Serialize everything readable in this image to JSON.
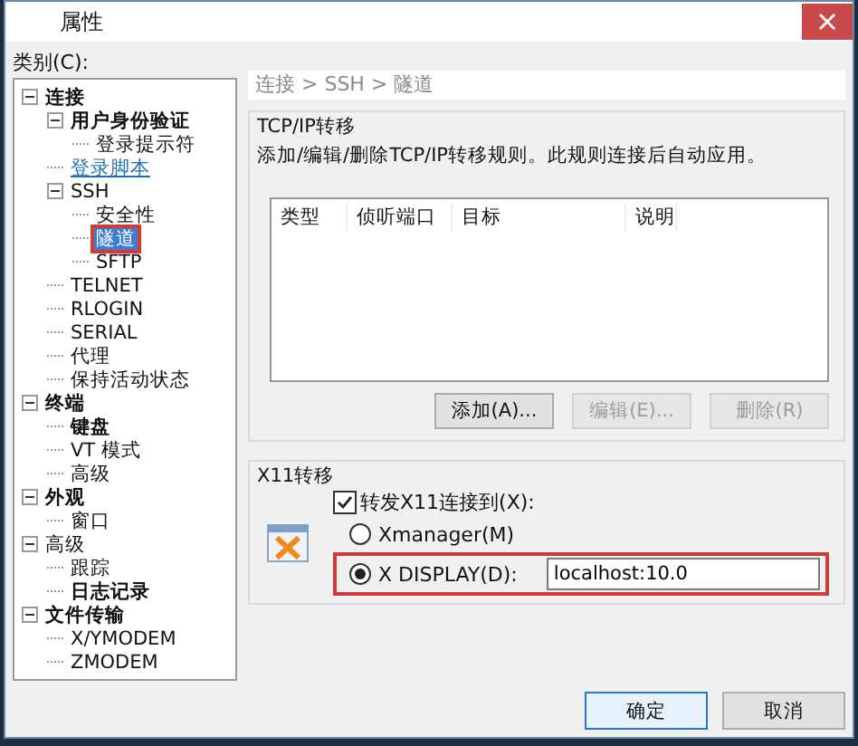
{
  "window": {
    "title": "属性"
  },
  "category_label": "类别(C):",
  "tree": [
    {
      "label": "连接",
      "kind": "bold",
      "expanded": true,
      "selected": false,
      "children": [
        {
          "label": "用户身份验证",
          "kind": "bold",
          "expanded": true,
          "selected": false,
          "children": [
            {
              "label": "登录提示符",
              "kind": "normal",
              "selected": false
            }
          ]
        },
        {
          "label": "登录脚本",
          "kind": "link",
          "selected": false
        },
        {
          "label": "SSH",
          "kind": "normal",
          "expanded": true,
          "selected": false,
          "children": [
            {
              "label": "安全性",
              "kind": "normal",
              "selected": false
            },
            {
              "label": "隧道",
              "kind": "normal",
              "selected": true
            },
            {
              "label": "SFTP",
              "kind": "normal",
              "selected": false
            }
          ]
        },
        {
          "label": "TELNET",
          "kind": "normal",
          "selected": false
        },
        {
          "label": "RLOGIN",
          "kind": "normal",
          "selected": false
        },
        {
          "label": "SERIAL",
          "kind": "normal",
          "selected": false
        },
        {
          "label": "代理",
          "kind": "normal",
          "selected": false
        },
        {
          "label": "保持活动状态",
          "kind": "normal",
          "selected": false
        }
      ]
    },
    {
      "label": "终端",
      "kind": "bold",
      "expanded": true,
      "selected": false,
      "children": [
        {
          "label": "键盘",
          "kind": "bold",
          "selected": false
        },
        {
          "label": "VT 模式",
          "kind": "normal",
          "selected": false
        },
        {
          "label": "高级",
          "kind": "normal",
          "selected": false
        }
      ]
    },
    {
      "label": "外观",
      "kind": "bold",
      "expanded": true,
      "selected": false,
      "children": [
        {
          "label": "窗口",
          "kind": "normal",
          "selected": false
        }
      ]
    },
    {
      "label": "高级",
      "kind": "normal",
      "expanded": true,
      "selected": false,
      "children": [
        {
          "label": "跟踪",
          "kind": "normal",
          "selected": false
        },
        {
          "label": "日志记录",
          "kind": "bold",
          "selected": false
        }
      ]
    },
    {
      "label": "文件传输",
      "kind": "bold",
      "expanded": true,
      "selected": false,
      "children": [
        {
          "label": "X/YMODEM",
          "kind": "normal",
          "selected": false
        },
        {
          "label": "ZMODEM",
          "kind": "normal",
          "selected": false
        }
      ]
    }
  ],
  "breadcrumb": "连接 > SSH > 隧道",
  "tcp_group": {
    "title": "TCP/IP转移",
    "description": "添加/编辑/删除TCP/IP转移规则。此规则连接后自动应用。",
    "columns": [
      "类型",
      "侦听端口",
      "目标",
      "说明"
    ],
    "buttons": [
      {
        "label": "添加(A)...",
        "disabled": false
      },
      {
        "label": "编辑(E)...",
        "disabled": true
      },
      {
        "label": "删除(R)",
        "disabled": true
      }
    ]
  },
  "x11_group": {
    "title": "X11转移",
    "forward": {
      "label": "转发X11连接到(X):",
      "checked": true
    },
    "options": [
      {
        "label": "Xmanager(M)",
        "selected": false
      },
      {
        "label": "X DISPLAY(D):",
        "selected": true,
        "value": "localhost:10.0"
      }
    ]
  },
  "buttons": [
    {
      "label": "确定",
      "default": true
    },
    {
      "label": "取消",
      "default": false
    }
  ]
}
